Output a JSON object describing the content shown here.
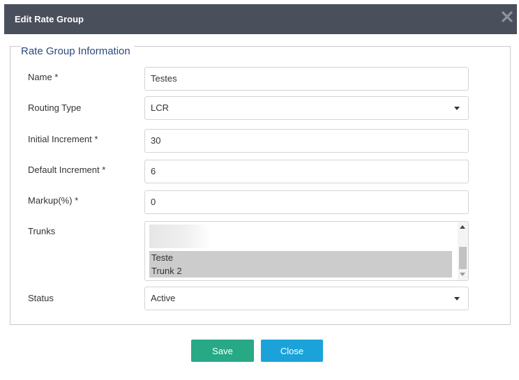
{
  "dialog": {
    "title": "Edit Rate Group",
    "close_icon": "close-x-icon"
  },
  "fieldset": {
    "legend": "Rate Group Information"
  },
  "form": {
    "name": {
      "label": "Name *",
      "value": "Testes"
    },
    "routing_type": {
      "label": "Routing Type",
      "value": "LCR"
    },
    "initial_increment": {
      "label": "Initial Increment *",
      "value": "30"
    },
    "default_increment": {
      "label": "Default Increment *",
      "value": "6"
    },
    "markup": {
      "label": "Markup(%) *",
      "value": "0"
    },
    "trunks": {
      "label": "Trunks",
      "options": [
        "Teste",
        "Trunk 2"
      ]
    },
    "status": {
      "label": "Status",
      "value": "Active"
    }
  },
  "buttons": {
    "save": "Save",
    "close": "Close"
  },
  "colors": {
    "titlebar": "#4a505b",
    "legend_text": "#2c4a7c",
    "save_button": "#27a986",
    "close_button": "#1ba3d9",
    "selected_option": "#cccccc"
  }
}
